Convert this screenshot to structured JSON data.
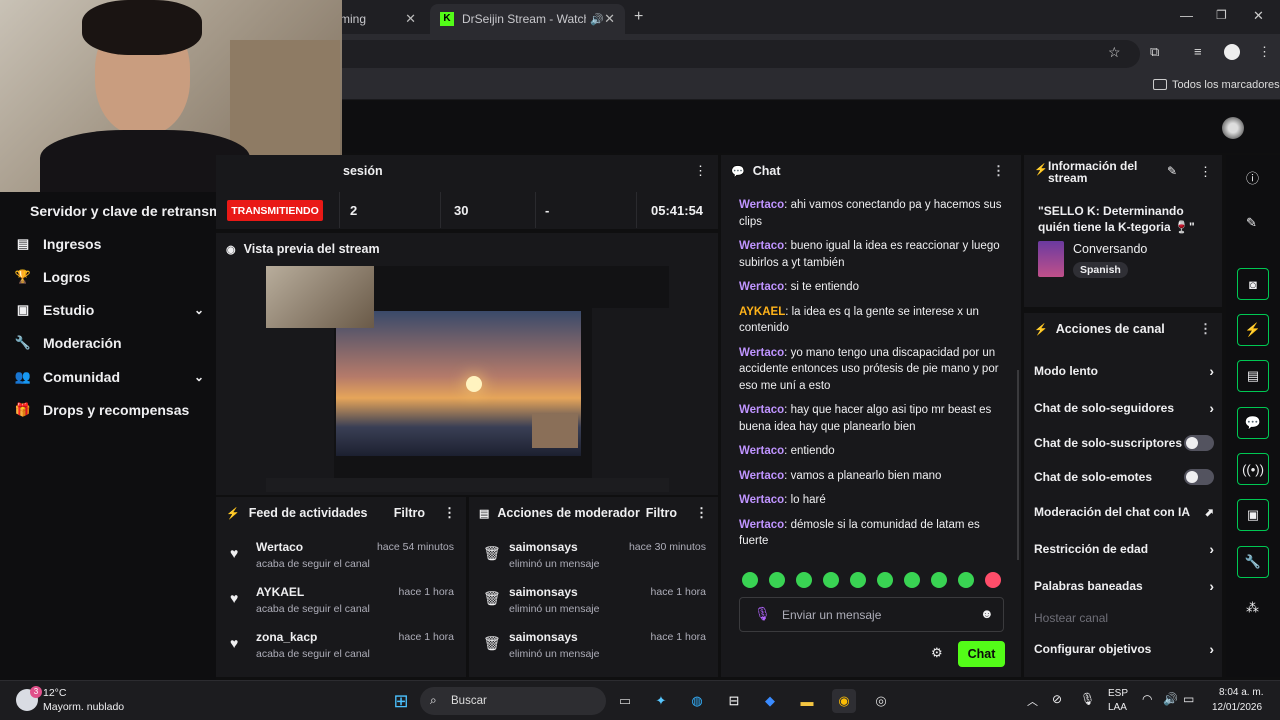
{
  "browser": {
    "tabs": [
      {
        "label": "ming"
      },
      {
        "label": "DrSeijin Stream - Watch Liv"
      }
    ],
    "bookmarks_label": "Todos los marcadores"
  },
  "sidebar": {
    "stream_key_label": "Servidor y clave de retransm",
    "items": [
      {
        "label": "Ingresos",
        "icon": "list-icon"
      },
      {
        "label": "Logros",
        "icon": "trophy-icon"
      },
      {
        "label": "Estudio",
        "icon": "studio-icon"
      },
      {
        "label": "Moderación",
        "icon": "wrench-icon"
      },
      {
        "label": "Comunidad",
        "icon": "people-icon"
      },
      {
        "label": "Drops y recompensas",
        "icon": "gift-icon"
      }
    ]
  },
  "session": {
    "title": "sesión",
    "status": "TRANSMITIENDO",
    "stats": [
      "2",
      "30",
      "-",
      "05:41:54"
    ]
  },
  "preview": {
    "title": "Vista previa del stream"
  },
  "activity_feed": {
    "title": "Feed de actividades",
    "filter_label": "Filtro",
    "items": [
      {
        "name": "Wertaco",
        "sub": "acaba de seguir el canal",
        "time": "hace 54 minutos"
      },
      {
        "name": "AYKAEL",
        "sub": "acaba de seguir el canal",
        "time": "hace 1 hora"
      },
      {
        "name": "zona_kacp",
        "sub": "acaba de seguir el canal",
        "time": "hace 1 hora"
      }
    ]
  },
  "mod_actions": {
    "title": "Acciones de moderador",
    "filter_label": "Filtro",
    "items": [
      {
        "name": "saimonsays",
        "sub": "eliminó un mensaje",
        "time": "hace 30 minutos"
      },
      {
        "name": "saimonsays",
        "sub": "eliminó un mensaje",
        "time": "hace 1 hora"
      },
      {
        "name": "saimonsays",
        "sub": "eliminó un mensaje",
        "time": "hace 1 hora"
      }
    ]
  },
  "chat": {
    "title": "Chat",
    "messages": [
      {
        "user": "Wertaco",
        "text": "ahi vamos conectando pa y hacemos sus clips",
        "color": "#bf94ff"
      },
      {
        "user": "Wertaco",
        "text": "bueno igual la idea es reaccionar y luego subirlos a yt también",
        "color": "#bf94ff"
      },
      {
        "user": "Wertaco",
        "text": "si te entiendo",
        "color": "#bf94ff"
      },
      {
        "user": "AYKAEL",
        "text": "la idea es q la gente se interese x un contenido",
        "color": "#ffb31a"
      },
      {
        "user": "Wertaco",
        "text": "yo mano tengo una discapacidad por un accidente entonces uso prótesis de pie mano y por eso me uní a esto",
        "color": "#bf94ff"
      },
      {
        "user": "Wertaco",
        "text": "hay que hacer algo asi tipo mr beast es buena idea hay que planearlo bien",
        "color": "#bf94ff"
      },
      {
        "user": "Wertaco",
        "text": "entiendo",
        "color": "#bf94ff"
      },
      {
        "user": "Wertaco",
        "text": "vamos a planearlo bien mano",
        "color": "#bf94ff"
      },
      {
        "user": "Wertaco",
        "text": "lo haré",
        "color": "#bf94ff"
      },
      {
        "user": "Wertaco",
        "text": "démosle si la comunidad de latam es fuerte",
        "color": "#bf94ff"
      }
    ],
    "input_placeholder": "Enviar un mensaje",
    "send_label": "Chat"
  },
  "stream_info": {
    "title_line1": "Información del",
    "title_line2": "stream",
    "stream_title": "\"SELLO K: Determinando quién tiene la K-tegoria 🍷\"",
    "category": "Conversando",
    "language": "Spanish"
  },
  "channel_actions": {
    "title": "Acciones de canal",
    "items": [
      {
        "label": "Modo lento",
        "control": "chevron"
      },
      {
        "label": "Chat de solo-seguidores",
        "control": "chevron"
      },
      {
        "label": "Chat de solo-suscriptores",
        "control": "toggle"
      },
      {
        "label": "Chat de solo-emotes",
        "control": "toggle"
      },
      {
        "label": "Moderación del chat con IA",
        "control": "external"
      },
      {
        "label": "Restricción de edad",
        "control": "chevron"
      },
      {
        "label": "Palabras baneadas",
        "control": "chevron"
      },
      {
        "label": "Hostear canal",
        "control": "none"
      },
      {
        "label": "Configurar objetivos",
        "control": "chevron"
      }
    ]
  },
  "taskbar": {
    "temp": "12°C",
    "weather": "Mayorm. nublado",
    "weather_badge": "3",
    "search_label": "Buscar",
    "lang1": "ESP",
    "lang2": "LAA",
    "time": "8:04 a. m.",
    "date": "12/01/2026"
  },
  "colors": {
    "accent_green": "#53fc18",
    "live_red": "#e91916",
    "username_purple": "#bf94ff",
    "username_orange": "#ffb31a"
  }
}
